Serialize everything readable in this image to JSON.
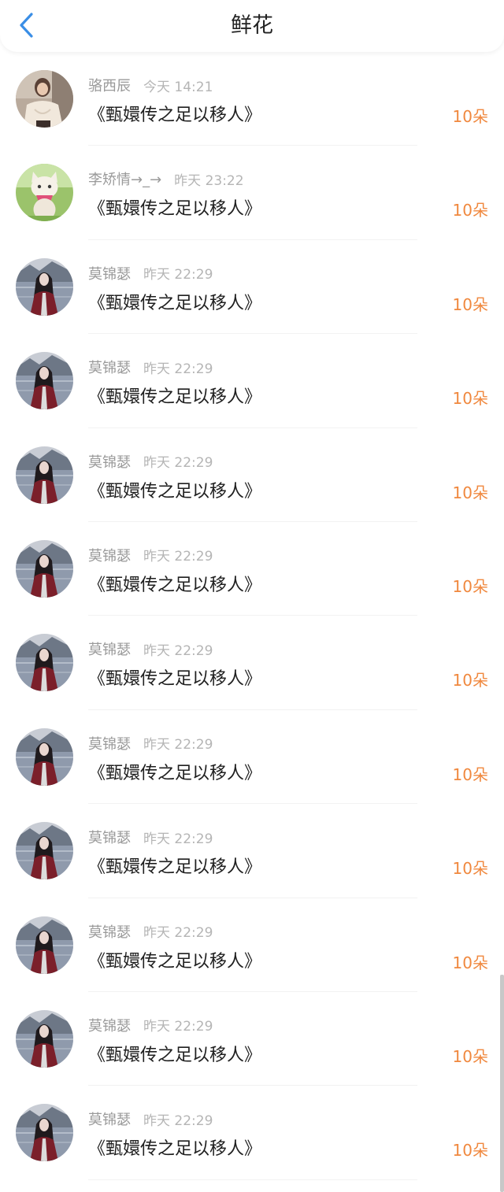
{
  "header": {
    "title": "鲜花",
    "back_icon": "chevron-left-icon",
    "accent_color": "#3a8ee6"
  },
  "colors": {
    "count": "#f0883e"
  },
  "rows": [
    {
      "user": "骆西辰",
      "time": "今天 14:21",
      "work": "《甄嬛传之足以移人》",
      "count": "10朵",
      "avatar": "woman-white-blouse"
    },
    {
      "user": "李矫情→_→",
      "time": "昨天 23:22",
      "work": "《甄嬛传之足以移人》",
      "count": "10朵",
      "avatar": "cartoon-cat"
    },
    {
      "user": "莫锦瑟",
      "time": "昨天 22:29",
      "work": "《甄嬛传之足以移人》",
      "count": "10朵",
      "avatar": "woman-by-lake"
    },
    {
      "user": "莫锦瑟",
      "time": "昨天 22:29",
      "work": "《甄嬛传之足以移人》",
      "count": "10朵",
      "avatar": "woman-by-lake"
    },
    {
      "user": "莫锦瑟",
      "time": "昨天 22:29",
      "work": "《甄嬛传之足以移人》",
      "count": "10朵",
      "avatar": "woman-by-lake"
    },
    {
      "user": "莫锦瑟",
      "time": "昨天 22:29",
      "work": "《甄嬛传之足以移人》",
      "count": "10朵",
      "avatar": "woman-by-lake"
    },
    {
      "user": "莫锦瑟",
      "time": "昨天 22:29",
      "work": "《甄嬛传之足以移人》",
      "count": "10朵",
      "avatar": "woman-by-lake"
    },
    {
      "user": "莫锦瑟",
      "time": "昨天 22:29",
      "work": "《甄嬛传之足以移人》",
      "count": "10朵",
      "avatar": "woman-by-lake"
    },
    {
      "user": "莫锦瑟",
      "time": "昨天 22:29",
      "work": "《甄嬛传之足以移人》",
      "count": "10朵",
      "avatar": "woman-by-lake"
    },
    {
      "user": "莫锦瑟",
      "time": "昨天 22:29",
      "work": "《甄嬛传之足以移人》",
      "count": "10朵",
      "avatar": "woman-by-lake"
    },
    {
      "user": "莫锦瑟",
      "time": "昨天 22:29",
      "work": "《甄嬛传之足以移人》",
      "count": "10朵",
      "avatar": "woman-by-lake"
    },
    {
      "user": "莫锦瑟",
      "time": "昨天 22:29",
      "work": "《甄嬛传之足以移人》",
      "count": "10朵",
      "avatar": "woman-by-lake"
    }
  ]
}
